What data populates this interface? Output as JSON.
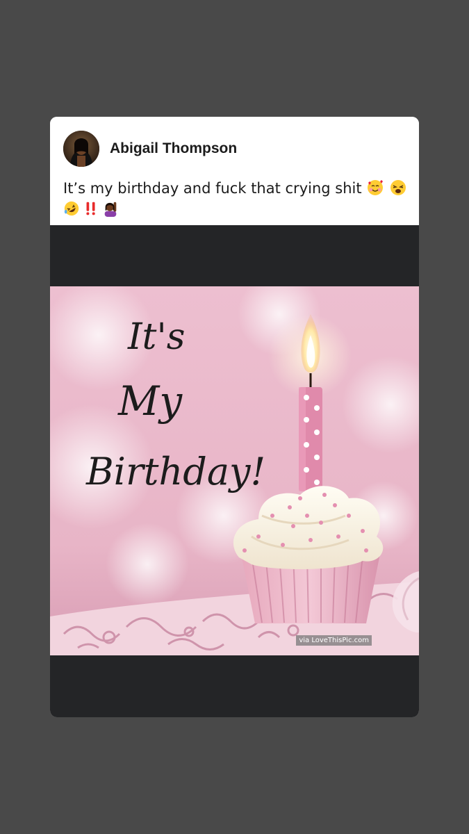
{
  "post": {
    "author_name": "Abigail Thompson",
    "text": "It’s my birthday and fuck that crying shit",
    "emojis": [
      "smiling-face-with-hearts",
      "weary-face",
      "rolling-on-floor-laughing",
      "double-exclamation",
      "woman-raising-hand"
    ]
  },
  "image": {
    "lettering": "It's My Birthday!",
    "watermark": "via LoveThisPic.com"
  },
  "colors": {
    "background": "#494949",
    "card": "#ffffff",
    "media_letterbox": "#242527",
    "photo_pink": "#e8b7c9"
  }
}
